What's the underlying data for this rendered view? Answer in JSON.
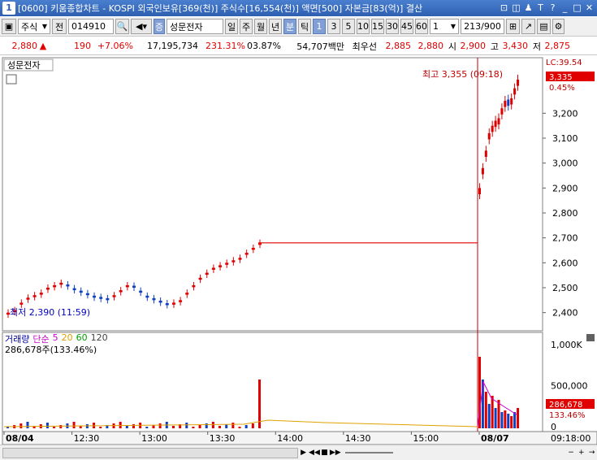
{
  "window": {
    "number": "1",
    "title": "[0600] 키움종합차트 - KOSPI 외국인보유[369(천)] 주식수[16,554(천)] 액면[500] 자본금[83(억)] 결산"
  },
  "toolbar": {
    "market": "주식",
    "market_arrow": "▼",
    "prev_label": "전",
    "code": "014910",
    "name": "성문전자",
    "badge": "증",
    "periods": [
      "일",
      "주",
      "월",
      "년",
      "분",
      "틱"
    ],
    "minutes": [
      "1",
      "3",
      "5",
      "10",
      "15",
      "30",
      "45",
      "60"
    ],
    "interval": "1",
    "count": "213/900"
  },
  "quote": {
    "price": "2,880",
    "change": "190",
    "change_pct": "+7.06%",
    "volume": "17,195,734",
    "vol_ratio": "231.31%",
    "turnover": "03.87%",
    "amount": "54,707백만",
    "best_label": "최우선",
    "best_bid": "2,885",
    "best_ask": "2,880",
    "open_label": "시",
    "open": "2,900",
    "high_label": "고",
    "high": "3,430",
    "low_label": "저",
    "low": "2,875"
  },
  "chart": {
    "stock_label": "성문전자",
    "lc_label": "LC:39.54",
    "lc_pct": "0.45%",
    "current_price": "3,335",
    "high_annotation": "최고 3,355 (09:18)",
    "low_annotation": "최저 2,390 (11:59)",
    "volume_title": "거래량",
    "ma_label": "단순",
    "ma_periods": [
      "5",
      "20",
      "60",
      "120"
    ],
    "volume_info": "286,678주(133.46%)",
    "volume_current": "286,678",
    "volume_pct": "133.46%",
    "time_readout": "09:18:00",
    "colors": {
      "up": "#e00000",
      "down": "#1040c0",
      "ma5": "#cc00cc",
      "ma20": "#e0a000",
      "ma60": "#00a000",
      "ma120": "#404040"
    }
  },
  "chart_data": {
    "type": "candlestick",
    "price_axis": {
      "ticks": [
        "3,200",
        "3,100",
        "3,000",
        "2,900",
        "2,800",
        "2,700",
        "2,600",
        "2,500",
        "2,400"
      ],
      "range": [
        2350,
        3400
      ]
    },
    "volume_axis": {
      "ticks": [
        "1,000K",
        "500,000",
        "0"
      ]
    },
    "time_ticks": [
      "08/04",
      "12:30",
      "13:00",
      "13:30",
      "14:00",
      "14:30",
      "15:00",
      "08/07"
    ],
    "day1_prices": [
      2400,
      2410,
      2440,
      2460,
      2470,
      2480,
      2500,
      2510,
      2520,
      2505,
      2490,
      2480,
      2470,
      2460,
      2455,
      2450,
      2470,
      2490,
      2510,
      2500,
      2480,
      2460,
      2450,
      2440,
      2430,
      2440,
      2450,
      2480,
      2510,
      2540,
      2560,
      2580,
      2590,
      2600,
      2610,
      2620,
      2640,
      2660,
      2680
    ],
    "flat_close": 2680,
    "day2_prices": [
      2900,
      2980,
      3050,
      3120,
      3150,
      3170,
      3180,
      3220,
      3250,
      3230,
      3260,
      3300,
      3335
    ]
  }
}
